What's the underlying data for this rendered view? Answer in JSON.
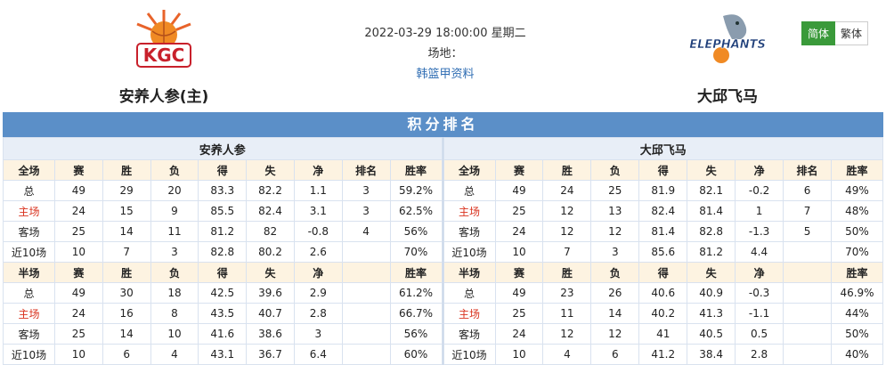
{
  "header": {
    "datetime": "2022-03-29 18:00:00 星期二",
    "venue_label": "场地：",
    "league_link": "韩篮甲资料",
    "home_team": "安养人参(主)",
    "away_team": "大邱飞马",
    "home_logo_text": "KGC",
    "away_logo_text": "ELEPHANTS",
    "lang_simplified": "简体",
    "lang_traditional": "繁体"
  },
  "board": {
    "title": "积分排名",
    "home": {
      "team_name": "安养人参",
      "full_cols": [
        "全场",
        "赛",
        "胜",
        "负",
        "得",
        "失",
        "净",
        "排名",
        "胜率"
      ],
      "full_rows": [
        [
          "总",
          "49",
          "29",
          "20",
          "83.3",
          "82.2",
          "1.1",
          "3",
          "59.2%"
        ],
        [
          "主场",
          "24",
          "15",
          "9",
          "85.5",
          "82.4",
          "3.1",
          "3",
          "62.5%"
        ],
        [
          "客场",
          "25",
          "14",
          "11",
          "81.2",
          "82",
          "-0.8",
          "4",
          "56%"
        ],
        [
          "近10场",
          "10",
          "7",
          "3",
          "82.8",
          "80.2",
          "2.6",
          "",
          "70%"
        ]
      ],
      "half_cols": [
        "半场",
        "赛",
        "胜",
        "负",
        "得",
        "失",
        "净",
        "",
        "胜率"
      ],
      "half_rows": [
        [
          "总",
          "49",
          "30",
          "18",
          "42.5",
          "39.6",
          "2.9",
          "",
          "61.2%"
        ],
        [
          "主场",
          "24",
          "16",
          "8",
          "43.5",
          "40.7",
          "2.8",
          "",
          "66.7%"
        ],
        [
          "客场",
          "25",
          "14",
          "10",
          "41.6",
          "38.6",
          "3",
          "",
          "56%"
        ],
        [
          "近10场",
          "10",
          "6",
          "4",
          "43.1",
          "36.7",
          "6.4",
          "",
          "60%"
        ]
      ]
    },
    "away": {
      "team_name": "大邱飞马",
      "full_cols": [
        "全场",
        "赛",
        "胜",
        "负",
        "得",
        "失",
        "净",
        "排名",
        "胜率"
      ],
      "full_rows": [
        [
          "总",
          "49",
          "24",
          "25",
          "81.9",
          "82.1",
          "-0.2",
          "6",
          "49%"
        ],
        [
          "主场",
          "25",
          "12",
          "13",
          "82.4",
          "81.4",
          "1",
          "7",
          "48%"
        ],
        [
          "客场",
          "24",
          "12",
          "12",
          "81.4",
          "82.8",
          "-1.3",
          "5",
          "50%"
        ],
        [
          "近10场",
          "10",
          "7",
          "3",
          "85.6",
          "81.2",
          "4.4",
          "",
          "70%"
        ]
      ],
      "half_cols": [
        "半场",
        "赛",
        "胜",
        "负",
        "得",
        "失",
        "净",
        "",
        "胜率"
      ],
      "half_rows": [
        [
          "总",
          "49",
          "23",
          "26",
          "40.6",
          "40.9",
          "-0.3",
          "",
          "46.9%"
        ],
        [
          "主场",
          "25",
          "11",
          "14",
          "40.2",
          "41.3",
          "-1.1",
          "",
          "44%"
        ],
        [
          "客场",
          "24",
          "12",
          "12",
          "41",
          "40.5",
          "0.5",
          "",
          "50%"
        ],
        [
          "近10场",
          "10",
          "4",
          "6",
          "41.2",
          "38.4",
          "2.8",
          "",
          "40%"
        ]
      ]
    }
  }
}
